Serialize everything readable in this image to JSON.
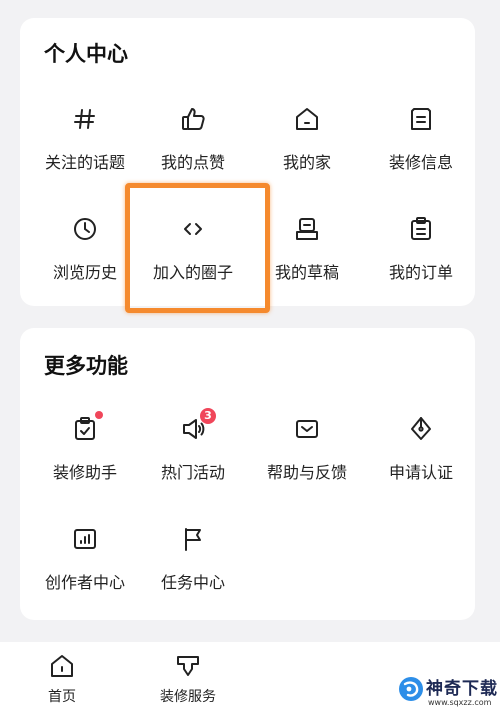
{
  "personal_center": {
    "title": "个人中心",
    "items": [
      {
        "label": "关注的话题",
        "icon": "hashtag-icon"
      },
      {
        "label": "我的点赞",
        "icon": "thumbs-up-icon"
      },
      {
        "label": "我的家",
        "icon": "home-icon"
      },
      {
        "label": "装修信息",
        "icon": "document-lines-icon"
      },
      {
        "label": "浏览历史",
        "icon": "clock-icon"
      },
      {
        "label": "加入的圈子",
        "icon": "code-brackets-icon"
      },
      {
        "label": "我的草稿",
        "icon": "draft-tray-icon"
      },
      {
        "label": "我的订单",
        "icon": "clipboard-icon"
      }
    ]
  },
  "more_features": {
    "title": "更多功能",
    "items": [
      {
        "label": "装修助手",
        "icon": "clipboard-check-icon",
        "badge_dot": true
      },
      {
        "label": "热门活动",
        "icon": "megaphone-icon",
        "badge": "3"
      },
      {
        "label": "帮助与反馈",
        "icon": "envelope-icon"
      },
      {
        "label": "申请认证",
        "icon": "pen-nib-icon"
      },
      {
        "label": "创作者中心",
        "icon": "bar-chart-icon"
      },
      {
        "label": "任务中心",
        "icon": "flag-icon"
      }
    ]
  },
  "tabbar": {
    "items": [
      {
        "label": "首页",
        "icon": "home-icon"
      },
      {
        "label": "装修服务",
        "icon": "service-icon"
      }
    ]
  },
  "watermark": {
    "text": "神奇下载",
    "url": "www.sqxzz.com"
  },
  "colors": {
    "highlight": "#f58a2e",
    "badge": "#f0465a",
    "background": "#f2f2f4"
  }
}
